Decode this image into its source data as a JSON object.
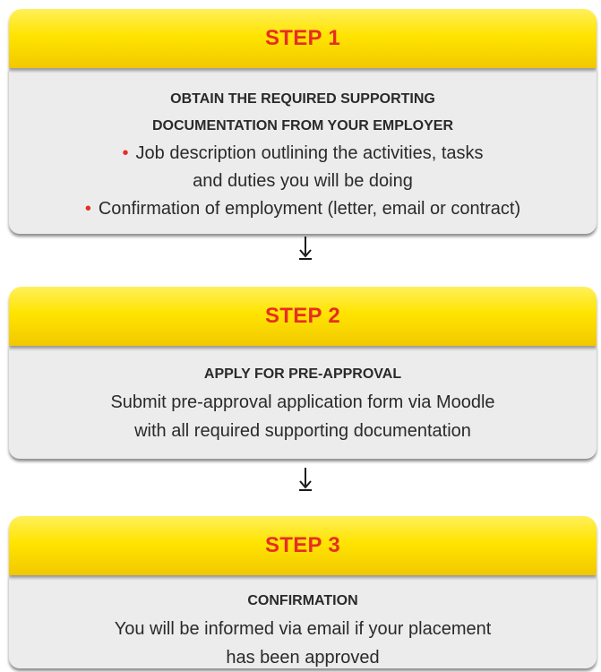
{
  "steps": [
    {
      "title": "STEP 1",
      "heading_lines": [
        "OBTAIN THE REQUIRED SUPPORTING",
        "DOCUMENTATION FROM YOUR EMPLOYER"
      ],
      "bullets": [
        [
          "Job description outlining the activities, tasks",
          "and duties you will be doing"
        ],
        [
          "Confirmation of employment (letter, email or contract)"
        ]
      ]
    },
    {
      "title": "STEP 2",
      "heading": "APPLY FOR PRE-APPROVAL",
      "text_lines": [
        "Submit pre-approval application form via Moodle",
        "with all required supporting documentation"
      ]
    },
    {
      "title": "STEP 3",
      "heading": "CONFIRMATION",
      "text_lines": [
        "You will be informed via email if your placement",
        "has been approved"
      ]
    }
  ],
  "colors": {
    "accent_red": "#e62e24",
    "header_yellow": "#ffe400",
    "body_gray": "#ececec"
  },
  "icons": [
    "arrow-down-icon"
  ]
}
